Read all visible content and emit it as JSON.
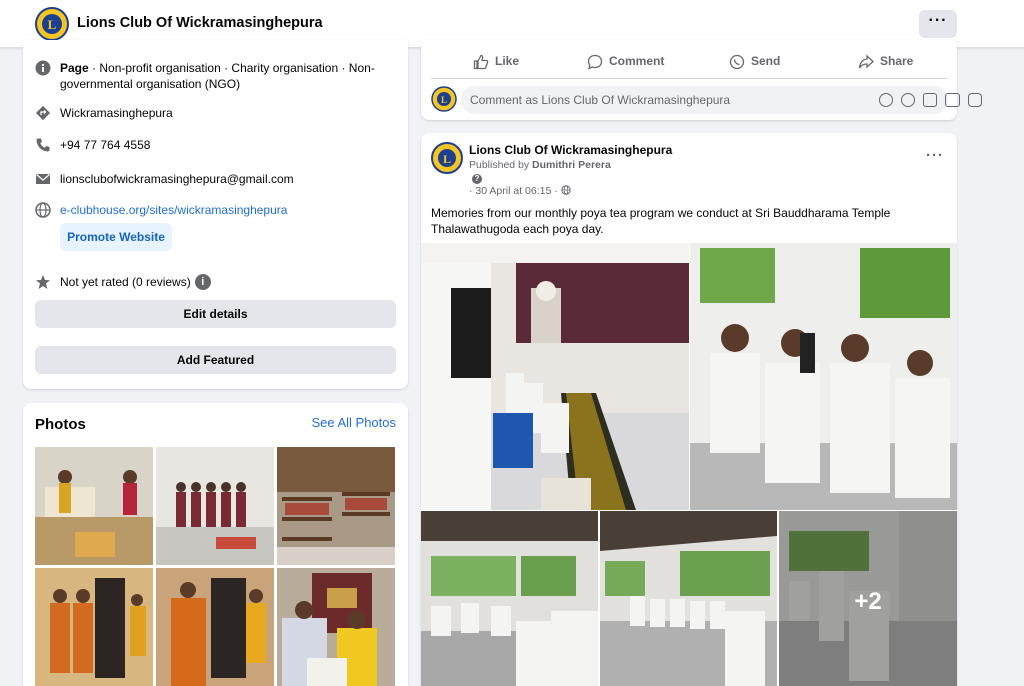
{
  "header": {
    "page_name": "Lions Club Of Wickramasinghepura",
    "more_label": "···"
  },
  "intro": {
    "category_prefix": "Page",
    "category": " · Non-profit organisation · Charity organisation · Non-governmental organisation (NGO)",
    "location": "Wickramasinghepura",
    "phone": "+94 77 764 4558",
    "email": "lionsclubofwickramasinghepura@gmail.com",
    "website": "e-clubhouse.org/sites/wickramasinghepura",
    "promote_label": "Promote Website",
    "rating": "Not yet rated (0 reviews)",
    "edit_details_label": "Edit details",
    "add_featured_label": "Add Featured"
  },
  "photos": {
    "title": "Photos",
    "see_all_label": "See All Photos"
  },
  "post_actions": {
    "like": "Like",
    "comment": "Comment",
    "send": "Send",
    "share": "Share",
    "comment_placeholder": "Comment as Lions Club Of Wickramasinghepura"
  },
  "post": {
    "author": "Lions Club Of Wickramasinghepura",
    "published_prefix": "Published by ",
    "published_by": "Dumithri Perera",
    "date": "· 30 April at 06:15 ·",
    "text": "Memories from our monthly poya tea program we conduct at Sri Bauddharama Temple Thalawathugoda each poya day.",
    "more_count": "+2",
    "more_label": "···"
  },
  "colors": {
    "accent": "#216fdb",
    "background": "#f0f2f5",
    "button_gray": "#e4e6eb"
  }
}
